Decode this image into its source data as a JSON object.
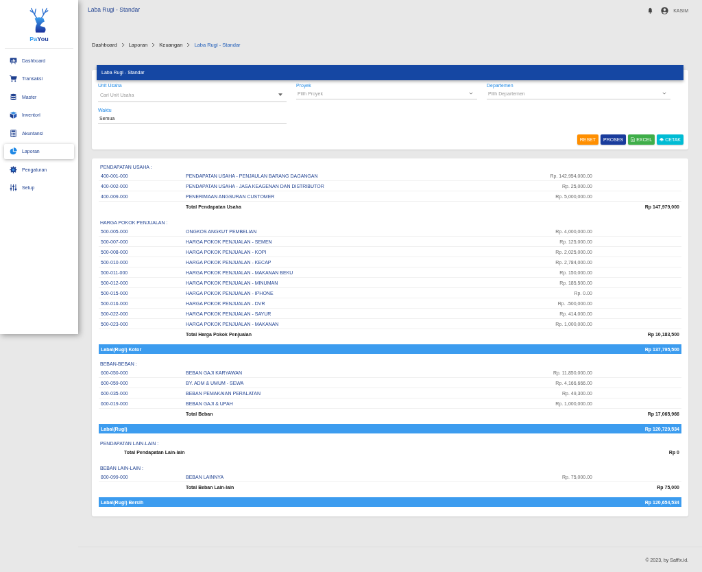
{
  "brand": {
    "first": "Pa",
    "second": "You"
  },
  "sidebar": {
    "items": [
      {
        "label": "Dashboard",
        "kind": "dashboard",
        "selected": false
      },
      {
        "label": "Transaksi",
        "kind": "cart",
        "selected": false
      },
      {
        "label": "Master",
        "kind": "database",
        "selected": false
      },
      {
        "label": "Inventori",
        "kind": "box",
        "selected": false
      },
      {
        "label": "Akuntansi",
        "kind": "calculator",
        "selected": false
      },
      {
        "label": "Laporan",
        "kind": "pie",
        "selected": true
      },
      {
        "label": "Pengaturan",
        "kind": "gear",
        "selected": false
      },
      {
        "label": "Setup",
        "kind": "sliders",
        "selected": false
      }
    ]
  },
  "topbar": {
    "title": "Laba Rugi - Standar",
    "user": "KASIM"
  },
  "breadcrumb": [
    {
      "label": "Dashboard",
      "selected": false
    },
    {
      "label": "Laporan",
      "selected": false
    },
    {
      "label": "Keuangan",
      "selected": false
    },
    {
      "label": "Laba Rugi - Standar",
      "selected": true
    }
  ],
  "filter": {
    "title": "Laba Rugi - Standar",
    "fields": [
      {
        "label": "Unit Usaha",
        "placeholder": "Cari Unit Usaha",
        "kind": "autocomplete"
      },
      {
        "label": "Proyek",
        "placeholder": "Pilih Proyek",
        "kind": "select"
      },
      {
        "label": "Departemen",
        "placeholder": "Pilih Departemen",
        "kind": "select"
      },
      {
        "label": "Waktu",
        "value": "Semua",
        "kind": "text"
      }
    ],
    "buttons": [
      {
        "label": "RESET",
        "kind": "reset"
      },
      {
        "label": "PROSES",
        "kind": "process"
      },
      {
        "label": "EXCEL",
        "kind": "excel"
      },
      {
        "label": "CETAK",
        "kind": "print"
      }
    ]
  },
  "report": [
    {
      "kind": "group",
      "title": "PENDAPATAN USAHA :",
      "rows": [
        {
          "code": "400-001-000",
          "name": "PENDAPATAN USAHA - PENJAULAN BARANG DAGANGAN",
          "amount": "Rp. 142,954,000.00"
        },
        {
          "code": "400-002-000",
          "name": "PENDAPATAN USAHA - JASA KEAGENAN DAN DISTRIBUTOR",
          "amount": "Rp. 25,000.00"
        },
        {
          "code": "400-009-000",
          "name": "PENERIMAAN ANGSURAN CUSTOMER",
          "amount": "Rp. 5,000,000.00"
        }
      ],
      "total": {
        "label": "Total Pendapatan Usaha",
        "amount": "Rp 147,979,000"
      }
    },
    {
      "kind": "group",
      "title": "HARGA POKOK PENJUALAN :",
      "rows": [
        {
          "code": "500-005-000",
          "name": "ONGKOS ANGKUT PEMBELIAN",
          "amount": "Rp. 4,000,000.00"
        },
        {
          "code": "500-007-000",
          "name": "HARGA POKOK PENJUALAN - SEMEN",
          "amount": "Rp. 125,000.00"
        },
        {
          "code": "500-008-000",
          "name": "HARGA POKOK PENJUALAN - KOPI",
          "amount": "Rp. 2,025,000.00"
        },
        {
          "code": "500-010-000",
          "name": "HARGA POKOK PENJUALAN - KECAP",
          "amount": "Rp. 2,784,000.00"
        },
        {
          "code": "500-011-000",
          "name": "HARGA POKOK PENJUALAN - MAKANAN BEKU",
          "amount": "Rp. 150,000.00"
        },
        {
          "code": "500-012-000",
          "name": "HARGA POKOK PENJUALAN - MINUMAN",
          "amount": "Rp. 185,500.00"
        },
        {
          "code": "500-015-000",
          "name": "HARGA POKOK PENJUALAN - IPHONE",
          "amount": "Rp. 0.00"
        },
        {
          "code": "500-016-000",
          "name": "HARGA POKOK PENJUALAN - DVR",
          "amount": "Rp. -500,000.00"
        },
        {
          "code": "500-022-000",
          "name": "HARGA POKOK PENJUALAN - SAYUR",
          "amount": "Rp. 414,000.00"
        },
        {
          "code": "500-023-000",
          "name": "HARGA POKOK PENJUALAN - MAKANAN",
          "amount": "Rp. 1,000,000.00"
        }
      ],
      "total": {
        "label": "Total Harga Pokok Penjualan",
        "amount": "Rp 10,183,500"
      }
    },
    {
      "kind": "summary",
      "label": "Laba/(Rugi) Kotor",
      "amount": "Rp 137,795,500"
    },
    {
      "kind": "group",
      "title": "BEBAN-BEBAN :",
      "rows": [
        {
          "code": "600-050-000",
          "name": "BEBAN GAJI KARYAWAN",
          "amount": "Rp. 11,850,000.00"
        },
        {
          "code": "600-059-000",
          "name": "BY. ADM & UMUM - SEWA",
          "amount": "Rp. 4,166,666.00"
        },
        {
          "code": "600-035-000",
          "name": "BEBAN PEMAKAIAN PERALATAN",
          "amount": "Rp. 49,300.00"
        },
        {
          "code": "600-019-000",
          "name": "BEBAN GAJI & UPAH",
          "amount": "Rp. 1,000,000.00"
        }
      ],
      "total": {
        "label": "Total Beban",
        "amount": "Rp 17,065,966"
      }
    },
    {
      "kind": "summary",
      "label": "Laba/(Rugi)",
      "amount": "Rp 120,729,534"
    },
    {
      "kind": "group",
      "title": "PENDAPATAN LAIN-LAIN :",
      "total": {
        "label": "Total Pendapatan Lain-lain",
        "amount": "Rp 0"
      }
    },
    {
      "kind": "group",
      "title": "BEBAN LAIN-LAIN :",
      "rows": [
        {
          "code": "800-099-000",
          "name": "BEBAN LAINNYA",
          "amount": "Rp. 75,000.00"
        }
      ],
      "total": {
        "label": "Total Beban Lain-lain",
        "amount": "Rp 75,000"
      }
    },
    {
      "kind": "summary",
      "label": "Laba/(Rugi) Bersih",
      "amount": "Rp 120,654,534"
    }
  ],
  "footer": "© 2023, by Saffix.id."
}
